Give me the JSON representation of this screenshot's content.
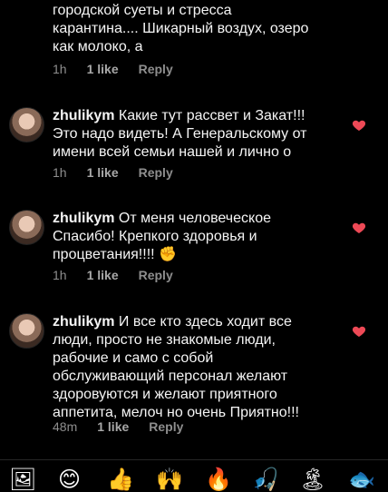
{
  "top_comment": {
    "lines": [
      "городской суеты и стресса",
      "карантина.... Шикарный воздух, озеро",
      "как молоко, а"
    ],
    "time": "1h",
    "likes": "1 like",
    "reply": "Reply"
  },
  "comments": [
    {
      "username": "zhulikym",
      "lines": [
        "Какие тут рассвет и Закат!!!",
        "Это надо видеть! А Генеральскому от",
        "имени всей семьи нашей и лично о"
      ],
      "time": "1h",
      "likes": "1 like",
      "reply": "Reply"
    },
    {
      "username": "zhulikym",
      "lines": [
        "От меня человеческое",
        "Спасибо! Крепкого здоровья и",
        "процветания!!!! ✊"
      ],
      "time": "1h",
      "likes": "1 like",
      "reply": "Reply"
    },
    {
      "username": "zhulikym",
      "lines": [
        "И все кто здесь ходит все",
        "люди, просто не знакомые люди,",
        "рабочие и само с собой",
        "обслуживающий персонал желают",
        "здоровуются и желают приятного",
        "аппетита, мелоч но очень Приятно!!!"
      ],
      "time": "48m",
      "likes": "1 like",
      "reply": "Reply"
    }
  ],
  "emoji_bar": [
    "🖼",
    "😊",
    "👍",
    "🙌",
    "🔥",
    "🎣",
    "🏝",
    "🐟"
  ],
  "colors": {
    "heart": "#ed4956",
    "meta": "#8e8e8e"
  }
}
